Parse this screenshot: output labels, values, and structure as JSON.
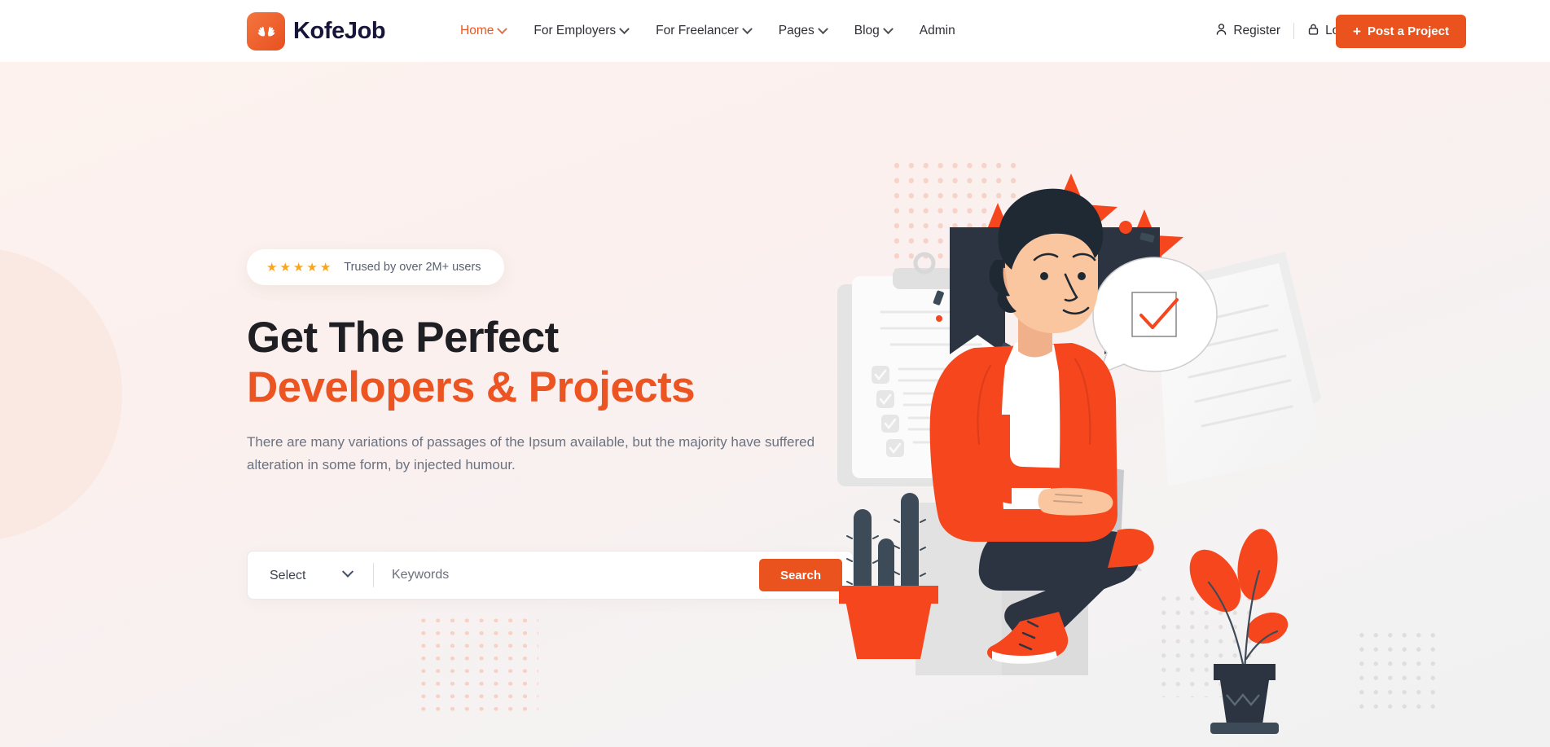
{
  "brand": {
    "name": "KofeJob",
    "logo_icon": "hands-star-logo-icon",
    "logo_bg": "#ea521e"
  },
  "nav": {
    "items": [
      {
        "label": "Home",
        "has_dropdown": true,
        "active": true
      },
      {
        "label": "For Employers",
        "has_dropdown": true,
        "active": false
      },
      {
        "label": "For Freelancer",
        "has_dropdown": true,
        "active": false
      },
      {
        "label": "Pages",
        "has_dropdown": true,
        "active": false
      },
      {
        "label": "Blog",
        "has_dropdown": true,
        "active": false
      },
      {
        "label": "Admin",
        "has_dropdown": false,
        "active": false
      }
    ]
  },
  "auth": {
    "register_label": "Register",
    "register_icon": "user-icon",
    "login_label": "Login",
    "login_icon": "lock-icon",
    "post_project_label": "Post a Project",
    "post_project_icon": "plus-icon"
  },
  "hero": {
    "badge": {
      "stars": 5,
      "star_color": "#fba51b",
      "text": "Trused by over 2M+ users"
    },
    "title_line1": "Get The Perfect",
    "title_line2": "Developers & Projects",
    "subtitle": "There are many variations of passages of the Ipsum available, but the majority have suffered alteration in some form, by injected humour.",
    "search": {
      "select_value": "Select",
      "select_options": [
        "Select"
      ],
      "keywords_placeholder": "Keywords",
      "search_button_label": "Search"
    },
    "illustration": "man-with-laptop-award-ribbon-illustration"
  },
  "colors": {
    "accent": "#ea521e",
    "accent_bright": "#fa4616",
    "dark": "#2b3440",
    "title_dark": "#1e1e23",
    "body_text": "#6b7280",
    "hero_bg_start": "#fdf2ee",
    "hero_bg_end": "#f1f1f2",
    "star_gold": "#fba51b"
  }
}
